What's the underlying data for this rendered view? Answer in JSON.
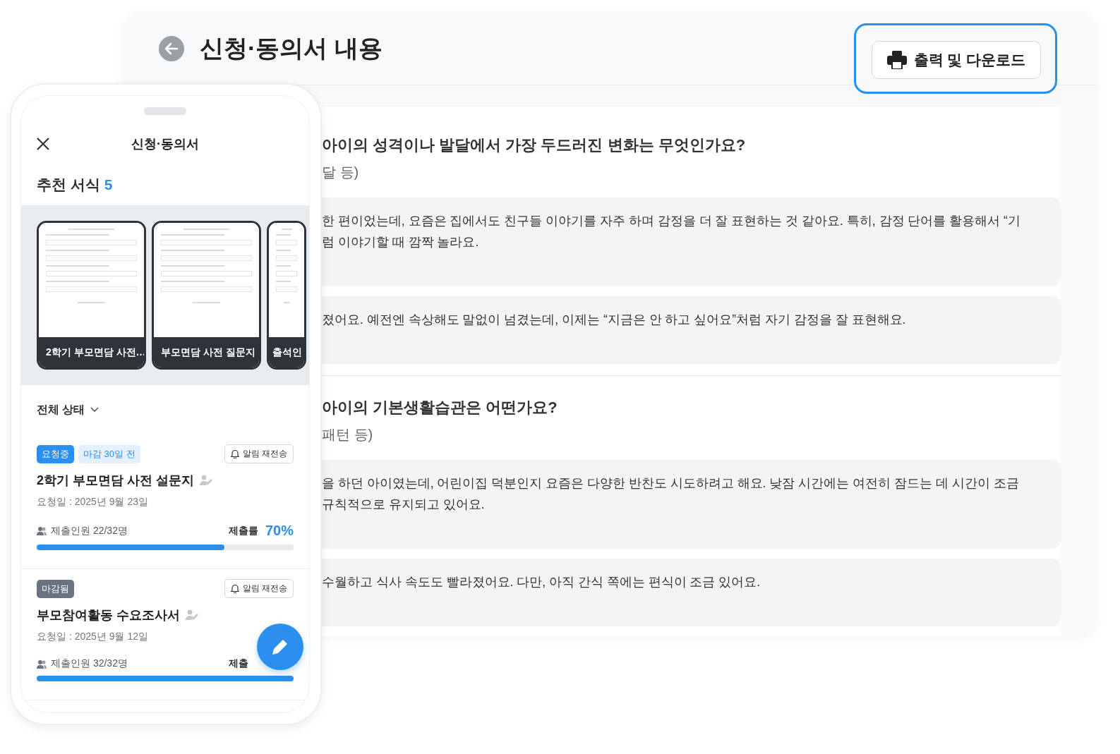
{
  "desktop": {
    "title": "신청·동의서 내용",
    "print_button": "출력 및 다운로드",
    "questions": [
      {
        "question": "아이의 성격이나 발달에서 가장 두드러진 변화는 무엇인가요?",
        "hint": "달 등)",
        "answers": [
          [
            "한 편이었는데, 요즘은 집에서도 친구들 이야기를 자주 하며 감정을 더 잘 표현하는 것 같아요. 특히, 감정 단어를 활용해서 “기",
            "럼 이야기할 때 깜짝 놀라요."
          ],
          [
            "졌어요. 예전엔 속상해도 말없이 넘겼는데, 이제는 “지금은 안 하고 싶어요”처럼 자기 감정을 잘 표현해요."
          ]
        ]
      },
      {
        "question": "아이의 기본생활습관은 어떤가요?",
        "hint": "패턴 등)",
        "answers": [
          [
            "을 하던 아이였는데, 어린이집 덕분인지 요즘은 다양한 반찬도 시도하려고 해요. 낮잠 시간에는 여전히 잠드는 데 시간이 조금",
            "규칙적으로 유지되고 있어요."
          ],
          [
            "수월하고 식사 속도도 빨라졌어요. 다만, 아직 간식 쪽에는 편식이 조금 있어요."
          ]
        ]
      }
    ]
  },
  "phone": {
    "title": "신청·동의서",
    "section_title": "추천 서식",
    "section_count": "5",
    "templates": [
      {
        "label": "2학기 부모면담 사전…"
      },
      {
        "label": "부모면담 사전 질문지"
      },
      {
        "label": "출석인"
      }
    ],
    "filter": "전체 상태",
    "items": [
      {
        "status": "요청중",
        "kind": "requesting",
        "deadline": "마감 30일 전",
        "resend": "알림 재전송",
        "title": "2학기 부모면담 사전 설문지",
        "date": "요청일 : 2025년 9월 23일",
        "count": "제출인원 22/32명",
        "rate_label": "제출률",
        "rate": "70%",
        "level": 0.73
      },
      {
        "status": "마감됨",
        "kind": "closed",
        "resend": "알림 재전송",
        "title": "부모참여활동 수요조사서",
        "date": "요청일 : 2025년 9월 12일",
        "count": "제출인원 32/32명",
        "rate_label": "제출",
        "level": 1
      }
    ]
  }
}
